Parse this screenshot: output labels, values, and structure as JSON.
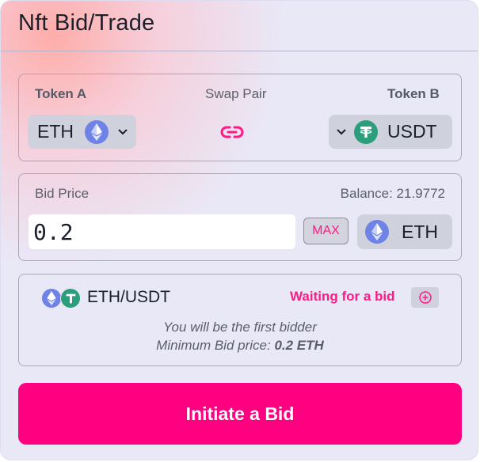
{
  "header": {
    "title": "Nft Bid/Trade"
  },
  "pair": {
    "token_a_label": "Token A",
    "swap_label": "Swap Pair",
    "token_b_label": "Token B",
    "token_a": {
      "symbol": "ETH",
      "icon": "ethereum-icon"
    },
    "token_b": {
      "symbol": "USDT",
      "icon": "tether-icon"
    }
  },
  "bid": {
    "label": "Bid Price",
    "balance": "Balance: 21.9772",
    "value": "0.2",
    "max_label": "MAX",
    "currency": "ETH"
  },
  "status": {
    "pair_name": "ETH/USDT",
    "state": "Waiting for a bid",
    "first_bidder": "You will be the first bidder",
    "min_bid_label": "Minimum Bid price:",
    "min_bid_value": "0.2 ETH"
  },
  "action": {
    "label": "Initiate a Bid"
  },
  "colors": {
    "accent": "#ff0080",
    "ethereum": "#6f82e6",
    "tether": "#2b9e7b",
    "panel_bg": "#e9e8f7"
  }
}
